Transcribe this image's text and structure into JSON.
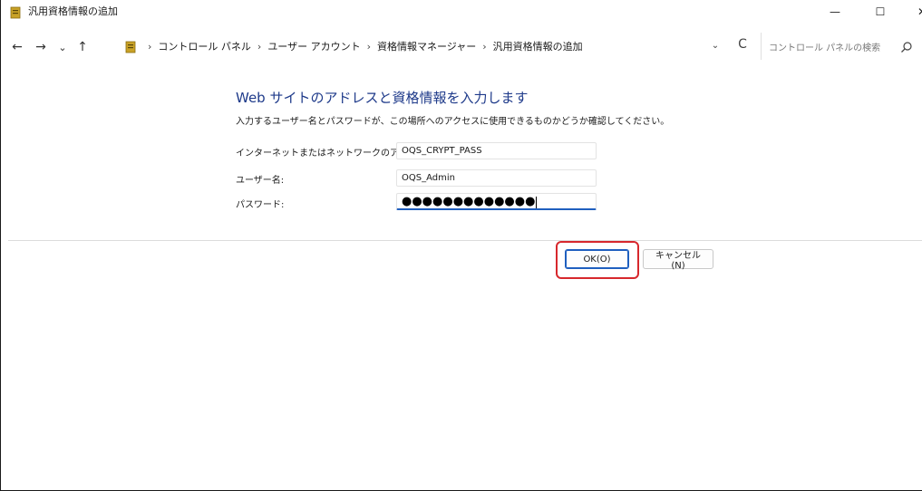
{
  "window": {
    "title": "汎用資格情報の追加",
    "controls": {
      "minimize": "—",
      "maximize": "☐",
      "close": "✕"
    }
  },
  "nav": {
    "back": "←",
    "forward": "→",
    "recent": "⌄",
    "up": "↑",
    "breadcrumbs": [
      "コントロール パネル",
      "ユーザー アカウント",
      "資格情報マネージャー",
      "汎用資格情報の追加"
    ],
    "separator": "›",
    "dropdown": "⌄",
    "refresh": "C",
    "search_placeholder": "コントロール パネルの検索"
  },
  "form": {
    "heading": "Web サイトのアドレスと資格情報を入力します",
    "description": "入力するユーザー名とパスワードが、この場所へのアクセスに使用できるものかどうか確認してください。",
    "address_label": "インターネットまたはネットワークのアドレス:",
    "address_value": "OQS_CRYPT_PASS",
    "username_label": "ユーザー名:",
    "username_value": "OQS_Admin",
    "password_label": "パスワード:",
    "password_value": "●●●●●●●●●●●●●"
  },
  "buttons": {
    "ok_label": "OK(O)",
    "cancel_label": "キャンセル(N)"
  },
  "colors": {
    "heading": "#1e3a8a",
    "accent": "#1f5fbf",
    "highlight": "#d7282d"
  }
}
